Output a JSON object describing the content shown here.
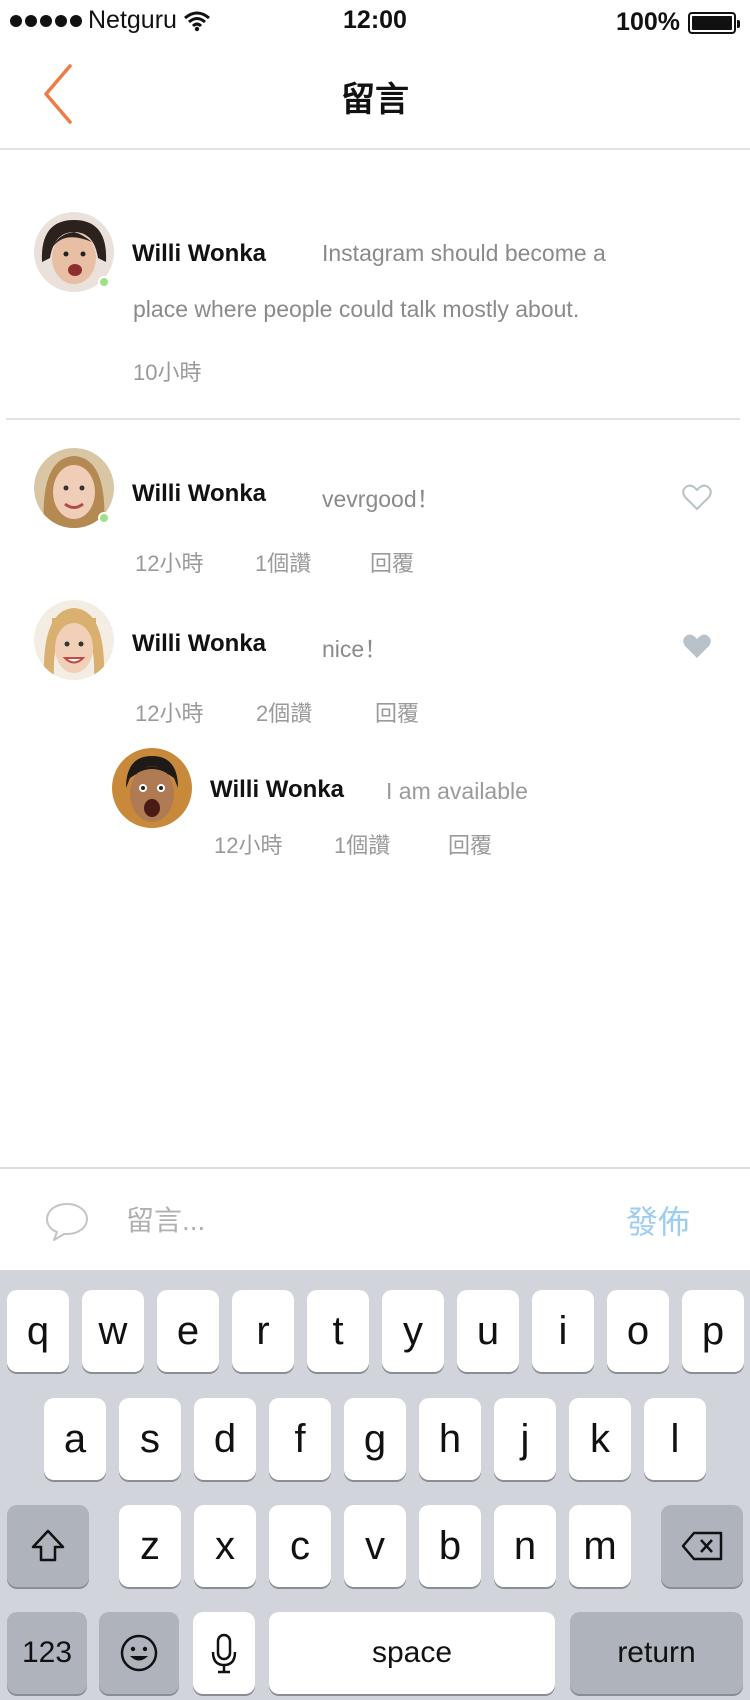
{
  "status_bar": {
    "carrier": "Netguru",
    "time": "12:00",
    "battery": "100%"
  },
  "nav": {
    "title": "留言"
  },
  "post": {
    "author": "Willi Wonka",
    "text_line1": "Instagram should become a",
    "text_line2": "place where  people could talk mostly about.",
    "time": "10小時"
  },
  "comments": [
    {
      "author": "Willi Wonka",
      "text": "vevrgood！",
      "time": "12小時",
      "likes": "1個讚",
      "reply": "回覆",
      "liked": false
    },
    {
      "author": "Willi Wonka",
      "text": "nice！",
      "time": "12小時",
      "likes": "2個讚",
      "reply": "回覆",
      "liked": true
    }
  ],
  "reply": {
    "author": "Willi Wonka",
    "text": "I am available",
    "time": "12小時",
    "likes": "1個讚",
    "reply": "回覆"
  },
  "input": {
    "placeholder": "留言...",
    "post_label": "發佈"
  },
  "keyboard": {
    "row1": [
      "q",
      "w",
      "e",
      "r",
      "t",
      "y",
      "u",
      "i",
      "o",
      "p"
    ],
    "row2": [
      "a",
      "s",
      "d",
      "f",
      "g",
      "h",
      "j",
      "k",
      "l"
    ],
    "row3": [
      "z",
      "x",
      "c",
      "v",
      "b",
      "n",
      "m"
    ],
    "numbers_label": "123",
    "space_label": "space",
    "return_label": "return"
  },
  "colors": {
    "accent_back": "#f07a4a",
    "online": "#9fe08a",
    "post_button": "#9dcdf0",
    "heart_filled": "#b8c2c8"
  }
}
